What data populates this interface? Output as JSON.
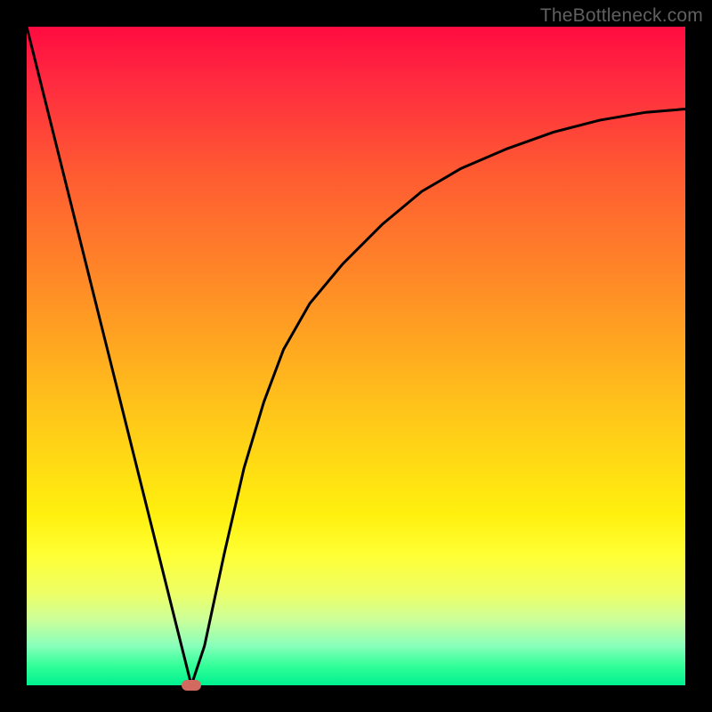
{
  "watermark": "TheBottleneck.com",
  "chart_data": {
    "type": "line",
    "title": "",
    "xlabel": "",
    "ylabel": "",
    "xlim": [
      0,
      100
    ],
    "ylim": [
      0,
      100
    ],
    "series": [
      {
        "name": "curve",
        "x": [
          0,
          2,
          5,
          8,
          11,
          14,
          17,
          20,
          22,
          24,
          25,
          27,
          30,
          33,
          36,
          39,
          43,
          48,
          54,
          60,
          66,
          73,
          80,
          87,
          94,
          100
        ],
        "y": [
          100,
          92,
          80,
          68,
          56,
          44,
          32,
          20,
          12,
          4,
          0,
          6,
          20,
          33,
          43,
          51,
          58,
          64,
          70,
          75,
          78.5,
          81.5,
          84,
          85.8,
          87,
          87.5
        ]
      }
    ],
    "vertex": {
      "x": 25,
      "y": 0
    },
    "background_gradient": {
      "top": "#ff0b40",
      "mid": "#ffc41a",
      "bottom": "#00f090"
    }
  }
}
